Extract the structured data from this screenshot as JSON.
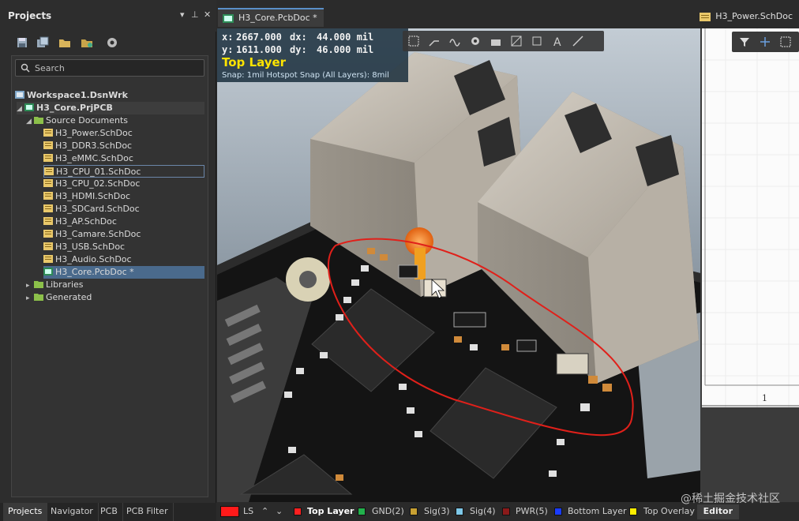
{
  "projects_panel": {
    "title": "Projects",
    "search_placeholder": "Search",
    "tree": {
      "workspace": "Workspace1.DsnWrk",
      "project": "H3_Core.PrjPCB",
      "source_folder": "Source Documents",
      "documents": [
        "H3_Power.SchDoc",
        "H3_DDR3.SchDoc",
        "H3_eMMC.SchDoc",
        "H3_CPU_01.SchDoc",
        "H3_CPU_02.SchDoc",
        "H3_HDMI.SchDoc",
        "H3_SDCard.SchDoc",
        "H3_AP.SchDoc",
        "H3_Camare.SchDoc",
        "H3_USB.SchDoc",
        "H3_Audio.SchDoc",
        "H3_Core.PcbDoc *"
      ],
      "libraries": "Libraries",
      "generated": "Generated"
    }
  },
  "bottom_tabs": [
    "Projects",
    "Navigator",
    "PCB",
    "PCB Filter"
  ],
  "doc_tabs": {
    "active": "H3_Core.PcbDoc *",
    "other": "H3_Power.SchDoc"
  },
  "hud": {
    "x_label": "x:",
    "x_value": "2667.000",
    "dx_label": "dx:",
    "dx_value": "44.000 mil",
    "y_label": "y:",
    "y_value": "1611.000",
    "dy_label": "dy:",
    "dy_value": "46.000 mil",
    "layer": "Top Layer",
    "snap": "Snap: 1mil Hotspot Snap (All Layers): 8mil"
  },
  "sheet": {
    "number": "1"
  },
  "layer_bar": {
    "ls_label": "LS",
    "layers": [
      {
        "name": "Top Layer",
        "color": "#ff2020",
        "active": true
      },
      {
        "name": "GND(2)",
        "color": "#22b14c"
      },
      {
        "name": "Sig(3)",
        "color": "#c8a032"
      },
      {
        "name": "Sig(4)",
        "color": "#7ec8e8"
      },
      {
        "name": "PWR(5)",
        "color": "#8a1a1a"
      },
      {
        "name": "Bottom Layer",
        "color": "#1a3cff"
      },
      {
        "name": "Top Overlay",
        "color": "#ffee00"
      }
    ],
    "editor": "Editor"
  },
  "watermark": "@稀土掘金技术社区",
  "colors": {
    "accent": "#5a8fc8",
    "selection": "#4a6a8c",
    "hud_layer": "#ffe400",
    "annotation": "#e0201a"
  }
}
